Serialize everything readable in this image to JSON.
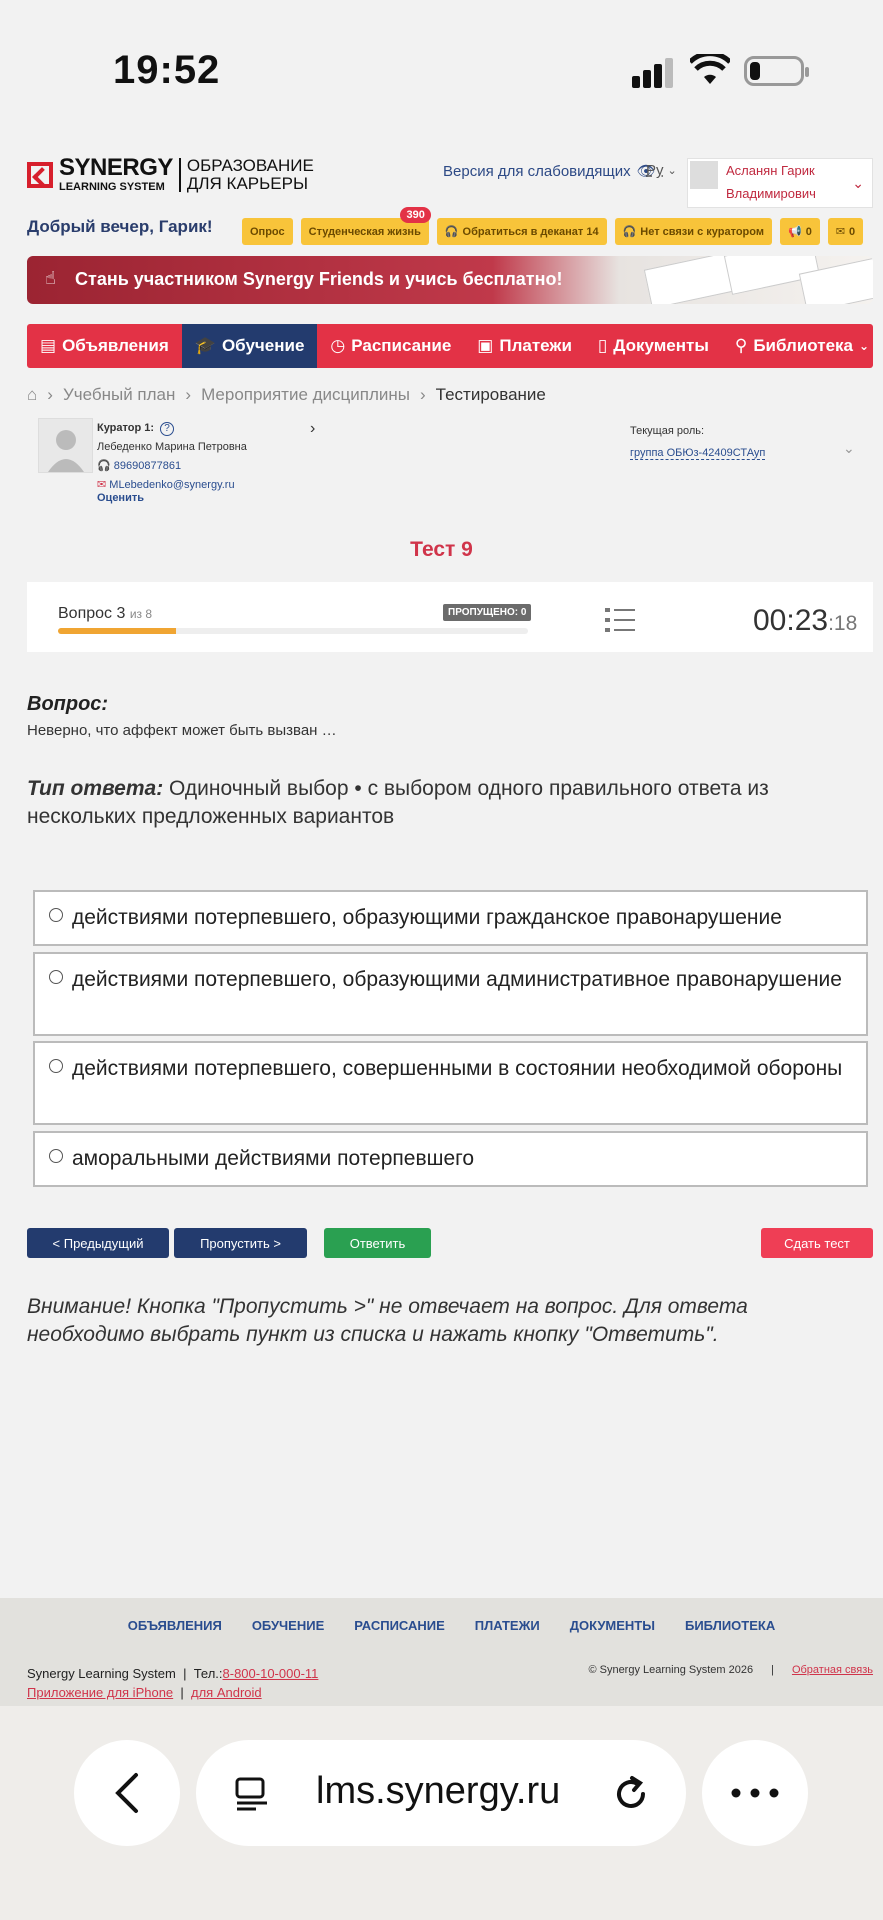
{
  "status": {
    "time": "19:52"
  },
  "header": {
    "logo_main": "SYNERGY",
    "logo_sub1": "LEARNING SYSTEM",
    "logo_tag1": "ОБРАЗОВАНИЕ",
    "logo_tag2": "ДЛЯ КАРЬЕРЫ",
    "accessibility": "Версия для слабовидящих",
    "lang": "Ру",
    "user_name_1": "Асланян Гарик",
    "user_name_2": "Владимирович",
    "greeting": "Добрый вечер, Гарик!"
  },
  "pills": {
    "poll": "Опрос",
    "student_life": "Студенческая жизнь",
    "student_life_badge": "390",
    "dean": "Обратиться в деканат 14",
    "curator": "Нет связи с куратором",
    "announce_count": "0",
    "mail_count": "0"
  },
  "banner": {
    "text": "Стань участником Synergy Friends и учись бесплатно!"
  },
  "nav": {
    "items": [
      "Объявления",
      "Обучение",
      "Расписание",
      "Платежи",
      "Документы",
      "Библиотека"
    ]
  },
  "breadcrumbs": [
    "Учебный план",
    "Мероприятие дисциплины",
    "Тестирование"
  ],
  "curator": {
    "title": "Куратор 1:",
    "name": "Лебеденко Марина Петровна",
    "phone": "89690877861",
    "email": "MLebedenko@synergy.ru",
    "rate": "Оценить",
    "role_label": "Текущая роль:",
    "role_value": "группа ОБЮз-42409СТАуп"
  },
  "test": {
    "title": "Тест 9",
    "question_label": "Вопрос 3",
    "question_of": "из 8",
    "skipped": "ПРОПУЩЕНО: 0",
    "progress_fraction": 0.25,
    "timer_main": "00:23",
    "timer_sec": "18"
  },
  "question": {
    "label": "Вопрос:",
    "text": "Неверно, что аффект может быть вызван …",
    "type_label": "Тип ответа:",
    "type_text": " Одиночный выбор • с выбором одного правильного ответа из нескольких предложенных вариантов",
    "options": [
      "действиями потерпевшего, образующими гражданское правонарушение",
      "действиями потерпевшего, образующими административное правонарушение",
      "действиями потерпевшего, совершенными в состоянии необходимой обороны",
      "аморальными действиями потерпевшего"
    ]
  },
  "buttons": {
    "prev": "< Предыдущий",
    "skip": "Пропустить >",
    "answer": "Ответить",
    "finish": "Сдать тест"
  },
  "warning": "Внимание! Кнопка \"Пропустить >\" не отвечает на вопрос. Для ответа необходимо выбрать пункт из списка и нажать кнопку \"Ответить\".",
  "footer": {
    "nav": [
      "ОБЪЯВЛЕНИЯ",
      "ОБУЧЕНИЕ",
      "РАСПИСАНИЕ",
      "ПЛАТЕЖИ",
      "ДОКУМЕНТЫ",
      "БИБЛИОТЕКА"
    ],
    "company": "Synergy Learning System",
    "phone_label": "Тел.:",
    "phone": "8-800-10-000-11",
    "app_iphone": "Приложение для iPhone",
    "app_android": "для Android",
    "copyright": "© Synergy Learning System 2026",
    "feedback": "Обратная связь"
  },
  "browser": {
    "url": "lms.synergy.ru"
  },
  "colors": {
    "brand_red": "#e33246",
    "navy": "#233b6e",
    "pill_yellow": "#f8c43a",
    "answer_green": "#2aa051"
  }
}
